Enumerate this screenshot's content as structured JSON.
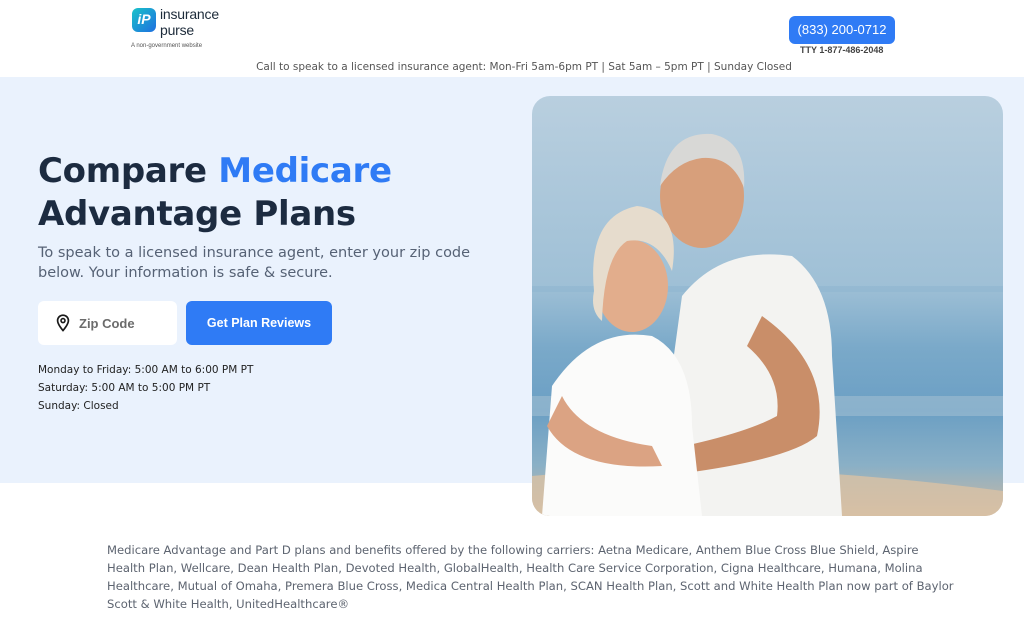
{
  "header": {
    "logo_icon_text": "iP",
    "logo_name_1": "insurance",
    "logo_name_2": "purse",
    "logo_tagline": "A non-government website",
    "phone": "(833) 200-0712",
    "tty": "TTY 1-877-486-2048",
    "hours_line": "Call to speak to a licensed insurance agent: Mon-Fri 5am-6pm PT | Sat 5am – 5pm PT | Sunday Closed"
  },
  "hero": {
    "title_prefix": "Compare ",
    "title_accent": "Medicare",
    "title_line2": "Advantage Plans",
    "subtitle": "To speak to a licensed insurance agent, enter your zip code below. Your information is safe & secure.",
    "zip_placeholder": "Zip Code",
    "zip_value": "",
    "cta_label": "Get Plan Reviews",
    "schedule": [
      "Monday to Friday: 5:00 AM to 6:00 PM PT",
      "Saturday: 5:00 AM to 5:00 PM PT",
      "Sunday: Closed"
    ]
  },
  "icons": {
    "location": "location-pin-icon",
    "logo": "insurance-purse-logo-icon"
  },
  "colors": {
    "accent": "#2f7bf5",
    "hero_bg": "#eaf2fd",
    "heading": "#1c2b40"
  },
  "footer": {
    "carriers_text": "Medicare Advantage and Part D plans and benefits offered by the following carriers: Aetna Medicare, Anthem Blue Cross Blue Shield, Aspire Health Plan, Wellcare, Dean Health Plan, Devoted Health, GlobalHealth, Health Care Service Corporation, Cigna Healthcare, Humana, Molina Healthcare, Mutual of Omaha, Premera Blue Cross, Medica Central Health Plan, SCAN Health Plan, Scott and White Health Plan now part of Baylor Scott & White Health, UnitedHealthcare®"
  }
}
